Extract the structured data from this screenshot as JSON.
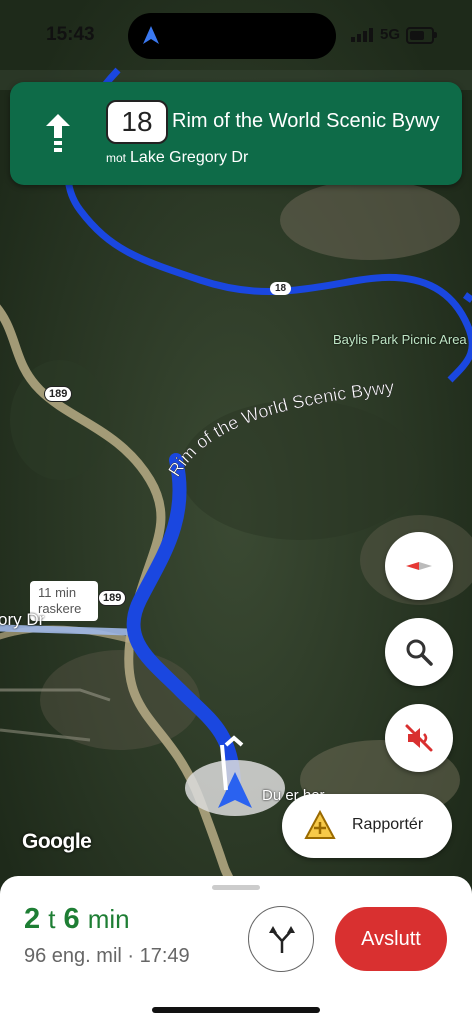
{
  "status_bar": {
    "time": "15:43",
    "network": "5G"
  },
  "banner": {
    "route_number": "18",
    "road_name": "Rim of the World Scenic Bywy",
    "toward_prefix": "mot",
    "toward_road": "Lake Gregory Dr"
  },
  "map": {
    "route_shield_18": "18",
    "route_shield_189_a": "189",
    "route_shield_189_b": "189",
    "poi_label": "Baylis Park Picnic Area",
    "road_label_curved": "Rim of the World Scenic Bywy",
    "partial_road_label": "ory Dr",
    "faster_route_line1": "11 min",
    "faster_route_line2": "raskere",
    "destination_label": "Du er her",
    "attribution": "Google"
  },
  "controls": {
    "compass": "compass-icon",
    "search": "search-icon",
    "mute": "volume-mute-icon",
    "report_label": "Rapportér"
  },
  "trip": {
    "eta_hours": "2",
    "eta_hours_unit": "t",
    "eta_minutes": "6",
    "eta_minutes_unit": "min",
    "distance_arrival": "96 eng. mil · 17:49",
    "end_button": "Avslutt"
  },
  "colors": {
    "banner": "#0e6b48",
    "route": "#1a47e0",
    "eta": "#1e7e34",
    "end_button": "#d93030"
  }
}
